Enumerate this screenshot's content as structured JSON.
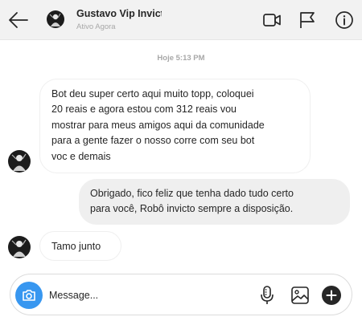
{
  "header": {
    "contact_name": "Gustavo Vip Invicto",
    "status": "Ativo Agora"
  },
  "conversation": {
    "timestamp": "Hoje 5:13 PM",
    "messages": [
      {
        "direction": "incoming",
        "lines": [
          "Bot deu super certo aqui muito topp, coloquei",
          "20 reais e agora estou com 312 reais vou",
          "mostrar para meus amigos aqui da comunidade",
          "para a gente fazer o nosso corre com seu bot",
          "voc e demais"
        ]
      },
      {
        "direction": "outgoing",
        "lines": [
          "Obrigado, fico feliz que tenha dado tudo certo",
          "para você, Robô invicto sempre a disposição."
        ]
      },
      {
        "direction": "incoming",
        "lines": [
          "Tamo junto"
        ]
      }
    ]
  },
  "composer": {
    "placeholder": "Message..."
  },
  "icons": {
    "back": "arrow-left-icon",
    "video": "video-camera-icon",
    "report": "flag-icon",
    "info": "info-icon",
    "camera": "camera-icon",
    "mic": "microphone-icon",
    "gallery": "image-icon",
    "more": "plus-circle-icon"
  },
  "colors": {
    "header_bg": "#f2f2f2",
    "outgoing_bubble": "#efefef",
    "camera_button": "#3897f0",
    "text": "#262626",
    "muted": "#a8a8a8"
  }
}
